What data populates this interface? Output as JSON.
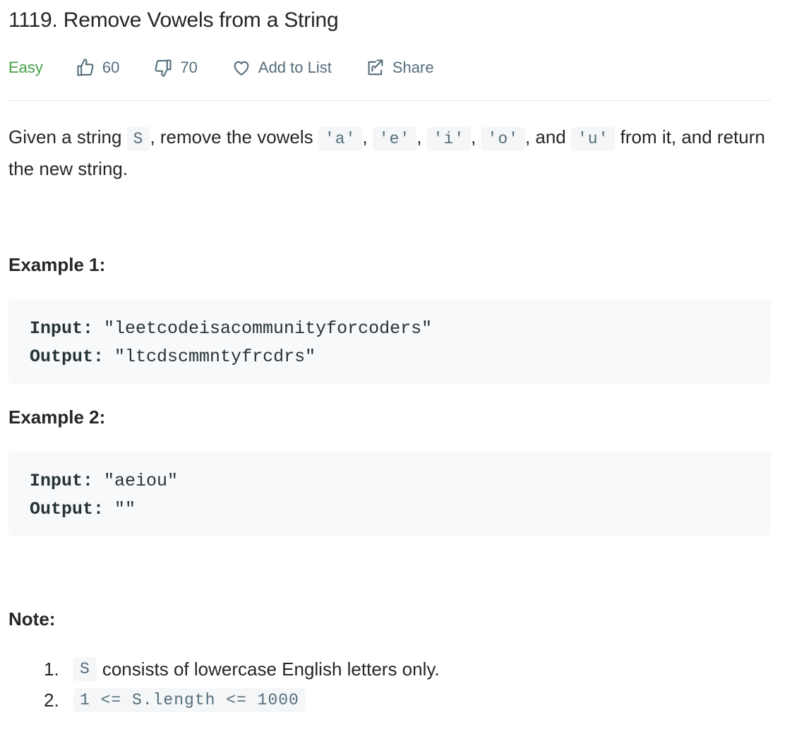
{
  "problem": {
    "title": "1119. Remove Vowels from a String",
    "difficulty": "Easy",
    "likes": "60",
    "dislikes": "70",
    "add_to_list_label": "Add to List",
    "share_label": "Share"
  },
  "description": {
    "part1": "Given a string ",
    "var_s": "S",
    "part2": ", remove the vowels ",
    "vowel_a": "'a'",
    "sep1": ", ",
    "vowel_e": "'e'",
    "sep2": ", ",
    "vowel_i": "'i'",
    "sep3": ", ",
    "vowel_o": "'o'",
    "sep4": ", and ",
    "vowel_u": "'u'",
    "part3": " from it, and return the new string."
  },
  "examples": [
    {
      "heading": "Example 1:",
      "input_label": "Input:",
      "input_value": " \"leetcodeisacommunityforcoders\"",
      "output_label": "Output:",
      "output_value": " \"ltcdscmmntyfrcdrs\""
    },
    {
      "heading": "Example 2:",
      "input_label": "Input:",
      "input_value": " \"aeiou\"",
      "output_label": "Output:",
      "output_value": " \"\""
    }
  ],
  "note": {
    "heading": "Note:",
    "items": [
      {
        "num": "1.",
        "code": "S",
        "text": "consists of lowercase English letters only."
      },
      {
        "num": "2.",
        "code": "1 <= S.length <= 1000",
        "text": ""
      }
    ]
  },
  "colors": {
    "difficulty_easy": "#43a047",
    "meta_text": "#546e7a",
    "code_bg": "#f7f9fa"
  },
  "icons": {
    "like": "thumbs-up-icon",
    "dislike": "thumbs-down-icon",
    "add_to_list": "heart-icon",
    "share": "share-icon"
  }
}
